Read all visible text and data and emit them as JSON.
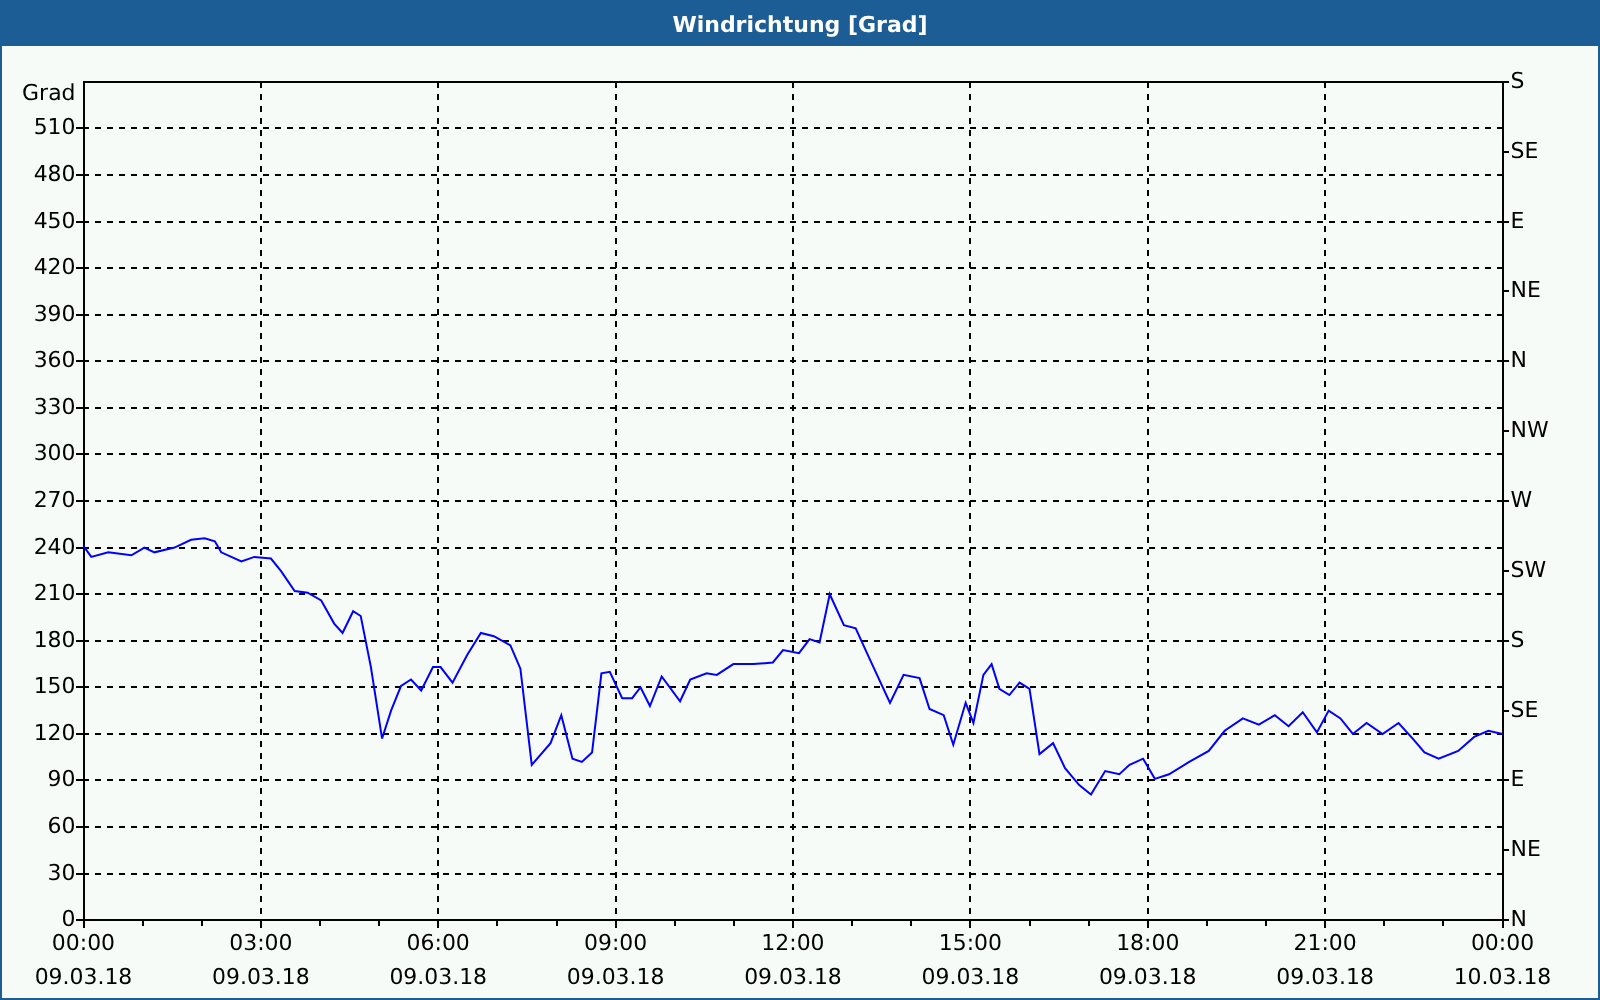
{
  "window": {
    "title": "Windrichtung [Grad]"
  },
  "chart": {
    "compass_labels": [
      "S",
      "SE",
      "E",
      "NE",
      "N",
      "NW",
      "W",
      "SW",
      "S",
      "SE",
      "E",
      "NE",
      "N"
    ],
    "date_labels": [
      "09.03.18",
      "09.03.18",
      "09.03.18",
      "09.03.18",
      "09.03.18",
      "09.03.18",
      "09.03.18",
      "09.03.18",
      "10.03.18"
    ],
    "chart_data": {
      "type": "line",
      "ylabel": "Grad",
      "grid": true,
      "xlim": [
        0,
        24
      ],
      "ylim": [
        0,
        540
      ],
      "xticks": [
        {
          "value": 0,
          "label": "00:00"
        },
        {
          "value": 3,
          "label": "03:00"
        },
        {
          "value": 6,
          "label": "06:00"
        },
        {
          "value": 9,
          "label": "09:00"
        },
        {
          "value": 12,
          "label": "12:00"
        },
        {
          "value": 15,
          "label": "15:00"
        },
        {
          "value": 18,
          "label": "18:00"
        },
        {
          "value": 21,
          "label": "21:00"
        },
        {
          "value": 24,
          "label": "00:00"
        }
      ],
      "yticks": [
        0,
        30,
        60,
        90,
        120,
        150,
        180,
        210,
        240,
        270,
        300,
        330,
        360,
        390,
        420,
        450,
        480,
        510
      ],
      "x": [
        0,
        0.13,
        0.42,
        0.81,
        1.03,
        1.2,
        1.54,
        1.82,
        2.05,
        2.22,
        2.33,
        2.67,
        2.89,
        3.17,
        3.34,
        3.57,
        3.79,
        4.02,
        4.24,
        4.38,
        4.56,
        4.69,
        4.86,
        5.05,
        5.2,
        5.37,
        5.54,
        5.71,
        5.91,
        6.04,
        6.24,
        6.49,
        6.72,
        6.94,
        7.22,
        7.39,
        7.58,
        7.9,
        8.08,
        8.27,
        8.43,
        8.6,
        8.76,
        8.9,
        9.11,
        9.28,
        9.42,
        9.58,
        9.78,
        10.09,
        10.26,
        10.54,
        10.71,
        10.99,
        11.33,
        11.66,
        11.83,
        12.1,
        12.28,
        12.45,
        12.62,
        12.86,
        13.06,
        13.3,
        13.64,
        13.87,
        14.14,
        14.31,
        14.55,
        14.71,
        14.92,
        15.05,
        15.22,
        15.36,
        15.49,
        15.66,
        15.83,
        16,
        16.17,
        16.4,
        16.6,
        16.84,
        17.04,
        17.28,
        17.52,
        17.69,
        17.92,
        18.12,
        18.36,
        18.7,
        19.03,
        19.3,
        19.61,
        19.88,
        20.15,
        20.38,
        20.62,
        20.86,
        21.06,
        21.26,
        21.47,
        21.7,
        21.97,
        22.24,
        22.48,
        22.68,
        22.92,
        23.25,
        23.52,
        23.76,
        24
      ],
      "series": [
        {
          "color": "#0000ff",
          "values": [
            241,
            234,
            237,
            235,
            240,
            237,
            240,
            245,
            246,
            244,
            237,
            231,
            234,
            233,
            225,
            212,
            211,
            206,
            191,
            185,
            199,
            196,
            163,
            117,
            135,
            151,
            155,
            148,
            163,
            163,
            153,
            171,
            185,
            183,
            177,
            162,
            100,
            114,
            132,
            104,
            102,
            108,
            159,
            160,
            143,
            143,
            150,
            138,
            157,
            141,
            155,
            159,
            158,
            165,
            165,
            166,
            174,
            172,
            181,
            179,
            210,
            190,
            188,
            168,
            140,
            158,
            156,
            136,
            132,
            113,
            140,
            127,
            158,
            165,
            149,
            145,
            153,
            149,
            107,
            114,
            98,
            87,
            81,
            96,
            94,
            100,
            104,
            91,
            94,
            102,
            109,
            122,
            130,
            126,
            132,
            125,
            134,
            121,
            135,
            130,
            120,
            127,
            120,
            127,
            117,
            108,
            104,
            109,
            118,
            122,
            120
          ]
        }
      ]
    }
  }
}
